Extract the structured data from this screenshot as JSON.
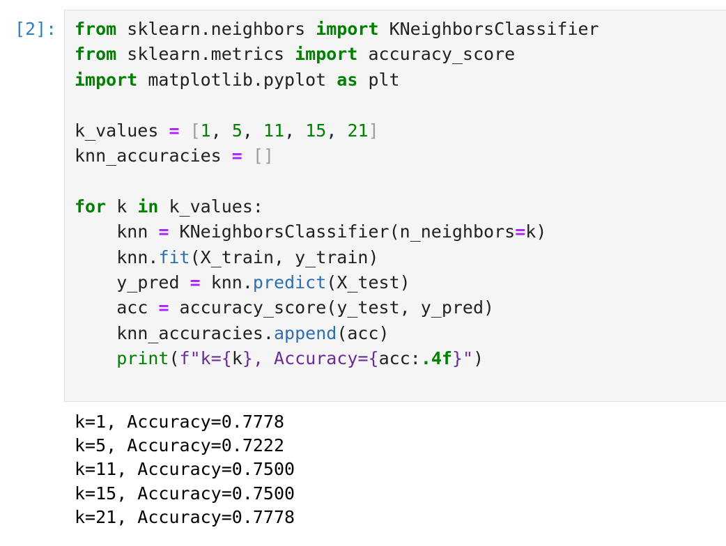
{
  "cell": {
    "prompt": "[2]:",
    "lines": {
      "l1": {
        "kw1": "from",
        "t1": " sklearn.neighbors ",
        "kw2": "import",
        "t2": " KNeighborsClassifier"
      },
      "l2": {
        "kw1": "from",
        "t1": " sklearn.metrics ",
        "kw2": "import",
        "t2": " accuracy_score"
      },
      "l3": {
        "kw1": "import",
        "t1": " matplotlib.pyplot ",
        "kw2": "as",
        "t2": " plt"
      },
      "l5": {
        "name": "k_values",
        "eq": "=",
        "ob": "[",
        "n1": "1",
        "n2": "5",
        "n3": "11",
        "n4": "15",
        "n5": "21",
        "cb": "]"
      },
      "l6": {
        "name": "knn_accuracies",
        "eq": "=",
        "brk": "[]"
      },
      "l8": {
        "kw1": "for",
        "t1": " k ",
        "kw2": "in",
        "t2": " k_values:"
      },
      "l9": {
        "indent": "    ",
        "name": "knn",
        "eq": "=",
        "call": " KNeighborsClassifier(n_neighbors",
        "eq2": "=",
        "end": "k)"
      },
      "l10": {
        "indent": "    ",
        "obj": "knn.",
        "method": "fit",
        "args": "(X_train, y_train)"
      },
      "l11": {
        "indent": "    ",
        "name": "y_pred",
        "eq": "=",
        "obj": " knn.",
        "method": "predict",
        "args": "(X_test)"
      },
      "l12": {
        "indent": "    ",
        "name": "acc",
        "eq": "=",
        "call": " accuracy_score(y_test, y_pred)"
      },
      "l13": {
        "indent": "    ",
        "obj": "knn_accuracies.",
        "method": "append",
        "args": "(acc)"
      },
      "l14": {
        "indent": "    ",
        "fn": "print",
        "p1": "(",
        "fprefix": "f\"k=",
        "b1": "{",
        "v1": "k",
        "b2": "}",
        "mid": ", Accuracy=",
        "b3": "{",
        "v2": "acc:",
        "fmt": ".4f",
        "b4": "}",
        "fend": "\"",
        "p2": ")"
      }
    }
  },
  "output": {
    "lines": [
      "k=1, Accuracy=0.7778",
      "k=5, Accuracy=0.7222",
      "k=11, Accuracy=0.7500",
      "k=15, Accuracy=0.7500",
      "k=21, Accuracy=0.7778"
    ]
  }
}
